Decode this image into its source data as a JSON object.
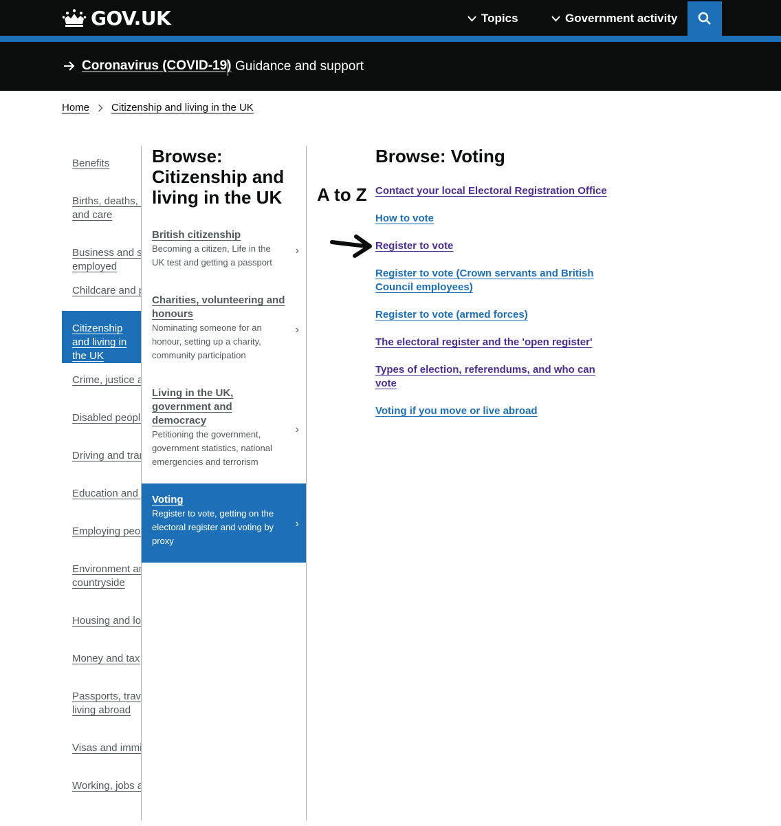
{
  "header": {
    "logo_text": "GOV.UK",
    "nav_topics": "Topics",
    "nav_government": "Government activity",
    "search_icon": "magnifier"
  },
  "covid_banner": {
    "link": "Coronavirus (COVID-19)",
    "text": "Guidance and support"
  },
  "breadcrumb": {
    "home": "Home",
    "current": "Citizenship and living in the UK"
  },
  "left_nav": {
    "items": [
      "Benefits",
      "Births, deaths, marriages and care",
      "Business and self-employed",
      "Childcare and parenting",
      "Citizenship and living in the UK",
      "Crime, justice and the law",
      "Disabled people",
      "Driving and transport",
      "Education and learning",
      "Employing people",
      "Environment and countryside",
      "Housing and local services",
      "Money and tax",
      "Passports, travel and living abroad",
      "Visas and immigration",
      "Working, jobs and pensions"
    ],
    "active_index": 4
  },
  "middle": {
    "title": "Browse: Citizenship and living in the UK",
    "topics": [
      {
        "title": "British citizenship",
        "desc": "Becoming a citizen, Life in the UK test and getting a passport"
      },
      {
        "title": "Charities, volunteering and honours",
        "desc": "Nominating someone for an honour, setting up a charity, community participation"
      },
      {
        "title": "Living in the UK, government and democracy",
        "desc": "Petitioning the government, government statistics, national emergencies and terrorism"
      },
      {
        "title": "Voting",
        "desc": "Register to vote, getting on the electoral register and voting by proxy"
      }
    ],
    "chevron": "›"
  },
  "atoz": "A to Z",
  "right": {
    "title": "Browse: Voting",
    "links": [
      "Contact your local Electoral Registration Office",
      "How to vote",
      "Register to vote",
      "Register to vote (Crown servants and British Council employees)",
      "Register to vote (armed forces)",
      "The electoral register and the 'open register'",
      "Types of election, referendums, and who can vote",
      "Voting if you move or live abroad"
    ]
  },
  "colors": {
    "header_bg": "#0b0c0c",
    "brand_blue": "#1d70b8",
    "link_blue": "#1d70b8",
    "visited_purple": "#4c2c92",
    "secondary_text": "#505a5f"
  }
}
